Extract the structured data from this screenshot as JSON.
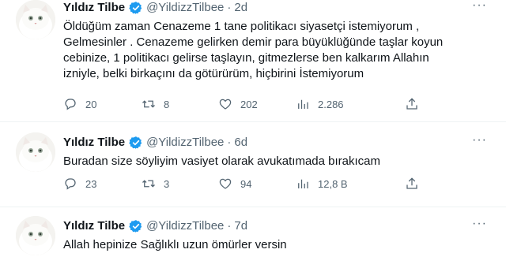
{
  "tweets": [
    {
      "author_name": "Yıldız Tilbe",
      "handle": "@YildizzTilbee",
      "separator": "·",
      "time": "2d",
      "text": "Öldüğüm zaman Cenazeme  1 tane politikacı siyasetçi  istemiyorum ,\nGelmesinler . Cenazeme gelirken demir para büyüklüğünde taşlar koyun\ncebinize, 1 politikacı gelirse taşlayın, gitmezlerse ben kalkarım Allahın\nizniyle, belki birkaçını da götürürüm, hiçbirini İstemiyorum",
      "replies": "20",
      "retweets": "8",
      "likes": "202",
      "views": "2.286"
    },
    {
      "author_name": "Yıldız Tilbe",
      "handle": "@YildizzTilbee",
      "separator": "·",
      "time": "6d",
      "text": "Buradan size söyliyim vasiyet olarak avukatımada bırakıcam",
      "replies": "23",
      "retweets": "3",
      "likes": "94",
      "views": "12,8 B"
    },
    {
      "author_name": "Yıldız Tilbe",
      "handle": "@YildizzTilbee",
      "separator": "·",
      "time": "7d",
      "text": "Allah hepinize Sağlıklı uzun ömürler versin"
    }
  ],
  "icons": {
    "verified": "verified-badge-icon",
    "more": "more-icon",
    "reply": "reply-icon",
    "retweet": "retweet-icon",
    "like": "heart-icon",
    "views": "views-icon",
    "share": "share-icon"
  },
  "colors": {
    "verified": "#1d9bf0",
    "text": "#0f1419",
    "secondary": "#536471",
    "divider": "#eff3f4"
  }
}
